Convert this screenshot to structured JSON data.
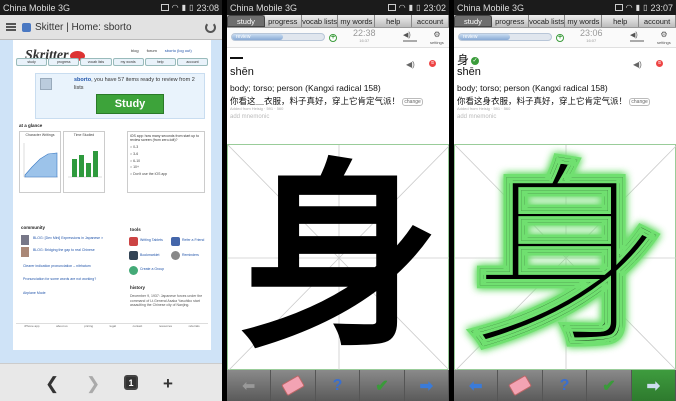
{
  "status": {
    "carrier": "China Mobile 3G",
    "times": [
      "23:08",
      "23:02",
      "23:07"
    ]
  },
  "browser": {
    "title": "Skitter | Home: sborto",
    "tab_count": "1",
    "nav_icons": [
      "back-arrow-icon",
      "forward-arrow-icon",
      "add-tab-icon"
    ]
  },
  "site": {
    "logo": "Skritter",
    "top_links": [
      "blog",
      "forum",
      "sborto  (log out)"
    ],
    "nav": [
      "study",
      "progress",
      "vocab lists",
      "my words",
      "help",
      "account"
    ],
    "greeting_user": "sborto",
    "greeting_msg": ", you have 57 items ready to review from 2 lists",
    "study_button": "Study",
    "at_a_glance": "at a glance",
    "card_titles": [
      "Character Writings",
      "Time Studied"
    ],
    "question": "iOS app: how many seconds from start up to review screen (from zero-tolt)?",
    "options": [
      "0-3",
      "3-6",
      "6-10",
      "10+",
      "Don't use the iOS app"
    ],
    "community": "community",
    "community_items": [
      "BLOG: [Dev Mini] Expressions in Japanese ×",
      "BLOG: Bridging the gap to real Chinese",
      "Clearer indication pronunciation – nitrhatum",
      "Pronunciation for some words are not working?",
      "Airplane Mode"
    ],
    "tools": "tools",
    "tools_items": [
      "Writing Tablets",
      "Refer a Friend",
      "Bookmarklet",
      "Reminders",
      "Create a Group"
    ],
    "history": "history",
    "history_text": "December 9, 1937: Japanese forces under the command of Lt.General Asaka Yasuhiko start assaulting the Chinese city of Nanjing.",
    "footer": [
      "iPhone app",
      "about us",
      "pricing",
      "legal",
      "contact",
      "resources",
      "referrals"
    ]
  },
  "study": {
    "tabs": [
      "study",
      "progress",
      "vocab lists",
      "my words",
      "help",
      "account"
    ],
    "progress_label": "review",
    "progress_fraction": 0.55,
    "timers": [
      {
        "time": "22:38",
        "sub": "16:37"
      },
      {
        "time": "23:06",
        "sub": "16:07"
      }
    ],
    "settings_label": "settings",
    "word_chars": [
      "",
      "身"
    ],
    "pinyin": "shēn",
    "definition": "body; torso; person (Kangxi radical 158)",
    "sentences": [
      "你看这＿衣服，料子真好，穿上它肯定气派！",
      "你看这身衣服，料子真好，穿上它肯定气派！"
    ],
    "change_label": "change",
    "meta_text": "Added from Heisig · 591 · 560",
    "mnemonic": "add mnemonic",
    "character": "身",
    "glow_color": "#6fe06f",
    "toolbar_icons": [
      "back-arrow-icon",
      "eraser-icon",
      "help-icon",
      "correct-icon",
      "next-arrow-icon"
    ]
  }
}
